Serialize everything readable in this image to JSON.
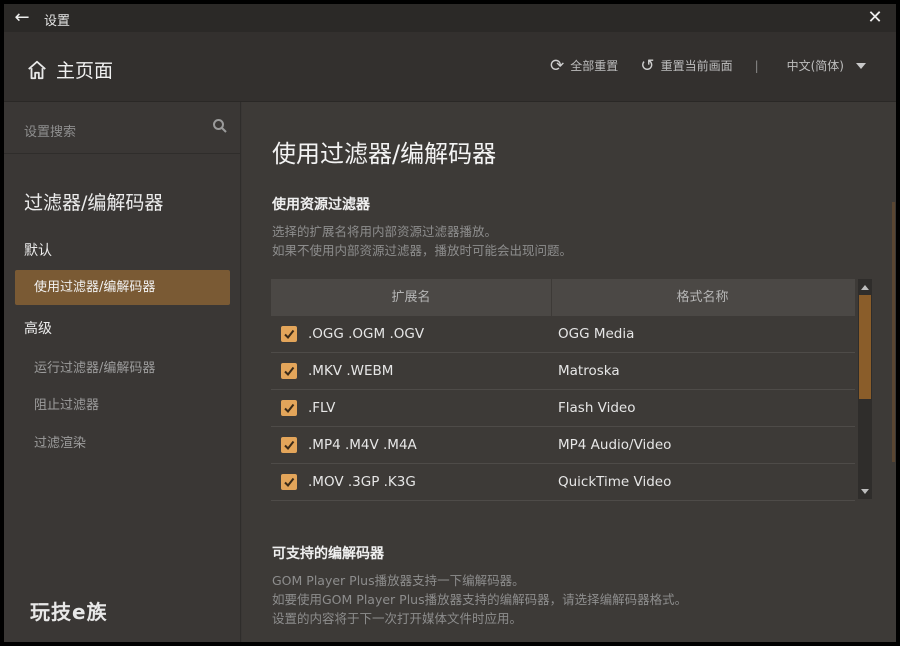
{
  "window": {
    "title": "设置"
  },
  "header": {
    "home_label": "主页面",
    "reset_all": "全部重置",
    "reset_current": "重置当前画面",
    "separator": "|",
    "language": "中文(简体)"
  },
  "sidebar": {
    "search_placeholder": "设置搜索",
    "section_title": "过滤器/编解码器",
    "groups": [
      {
        "label": "默认",
        "items": [
          {
            "label": "使用过滤器/编解码器",
            "active": true
          }
        ]
      },
      {
        "label": "高级",
        "items": [
          {
            "label": "运行过滤器/编解码器",
            "active": false
          },
          {
            "label": "阻止过滤器",
            "active": false
          },
          {
            "label": "过滤渲染",
            "active": false
          }
        ]
      }
    ],
    "brand": "玩技e族"
  },
  "main": {
    "title": "使用过滤器/编解码器",
    "source_filter": {
      "title": "使用资源过滤器",
      "desc_line1": "选择的扩展名将用内部资源过滤器播放。",
      "desc_line2": "如果不使用内部资源过滤器，播放时可能会出现问题。",
      "columns": [
        "扩展名",
        "格式名称"
      ],
      "rows": [
        {
          "ext": ".OGG .OGM .OGV",
          "format": "OGG Media",
          "checked": true
        },
        {
          "ext": ".MKV .WEBM",
          "format": "Matroska",
          "checked": true
        },
        {
          "ext": ".FLV",
          "format": "Flash Video",
          "checked": true
        },
        {
          "ext": ".MP4 .M4V .M4A",
          "format": "MP4 Audio/Video",
          "checked": true
        },
        {
          "ext": ".MOV .3GP .K3G",
          "format": "QuickTime Video",
          "checked": true
        }
      ]
    },
    "codecs": {
      "title": "可支持的编解码器",
      "desc_line1": "GOM Player Plus播放器支持一下编解码器。",
      "desc_line2": "如要使用GOM Player Plus播放器支持的编解码器，请选择编解码器格式。",
      "desc_line3": "设置的内容将于下一次打开媒体文件时应用。"
    }
  },
  "colors": {
    "accent": "#7a5a34",
    "checkbox": "#e3a55a",
    "scroll_thumb": "#8a5d2a"
  }
}
